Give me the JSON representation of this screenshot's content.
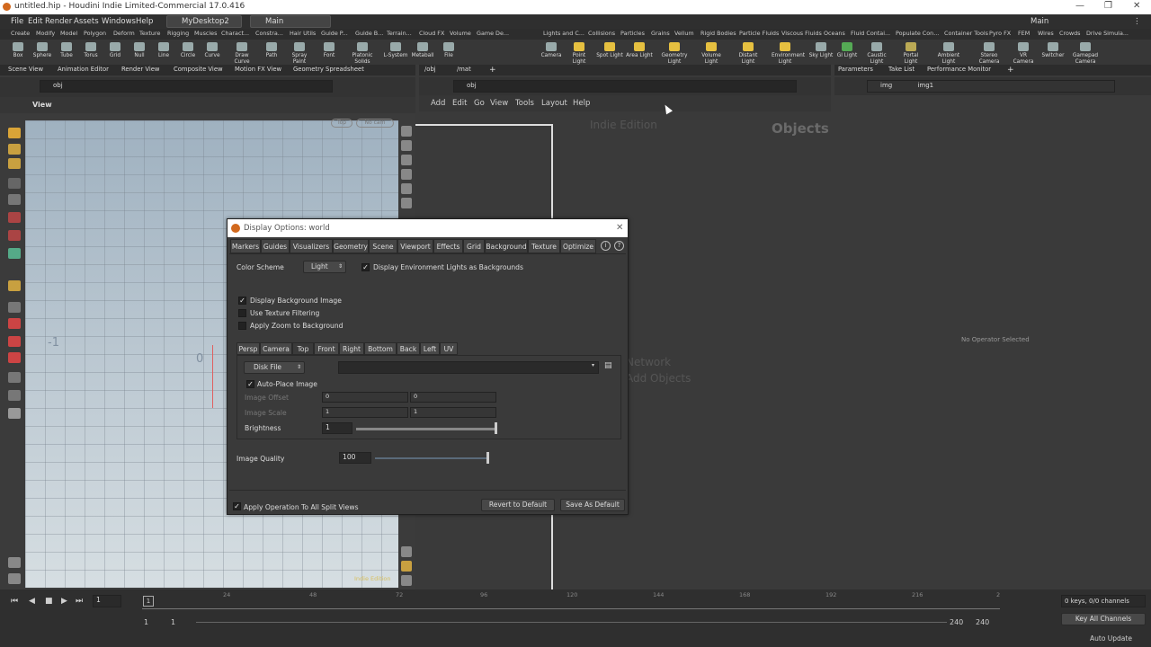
{
  "window": {
    "title": "untitled.hip - Houdini Indie Limited-Commercial 17.0.416",
    "controls": [
      "—",
      "❐",
      "✕"
    ]
  },
  "menu": {
    "items": [
      "File",
      "Edit",
      "Render",
      "Assets",
      "Windows",
      "Help"
    ],
    "desktop": "MyDesktop2",
    "workspace": "Main",
    "right_label": "Main"
  },
  "shelf_tabs_left": [
    "Create",
    "Modify",
    "Model",
    "Polygon",
    "Deform",
    "Texture",
    "Rigging",
    "Muscles",
    "Charact...",
    "Constra...",
    "Hair Utils",
    "Guide P...",
    "Guide B...",
    "Terrain...",
    "Cloud FX",
    "Volume",
    "Game De..."
  ],
  "shelf_tabs_right": [
    "Lights and C...",
    "Collisions",
    "Particles",
    "Grains",
    "Vellum",
    "Rigid Bodies",
    "Particle Fluids",
    "Viscous Fluids",
    "Oceans",
    "Fluid Contai...",
    "Populate Con...",
    "Container Tools",
    "Pyro FX",
    "FEM",
    "Wires",
    "Crowds",
    "Drive Simula..."
  ],
  "tools_left": [
    "Box",
    "Sphere",
    "Tube",
    "Torus",
    "Grid",
    "Null",
    "Line",
    "Circle",
    "Curve",
    "Draw Curve",
    "Path",
    "Spray Paint",
    "Font",
    "Platonic Solids",
    "L-System",
    "Metaball",
    "File"
  ],
  "tools_right": [
    "Camera",
    "Point Light",
    "Spot Light",
    "Area Light",
    "Geometry Light",
    "Volume Light",
    "Distant Light",
    "Environment Light",
    "Sky Light",
    "GI Light",
    "Caustic Light",
    "Portal Light",
    "Ambient Light",
    "Stereo Camera",
    "VR Camera",
    "Switcher",
    "Gamepad Camera"
  ],
  "left_panel": {
    "tabs": [
      "Scene View",
      "Animation Editor",
      "Render View",
      "Composite View",
      "Motion FX View",
      "Geometry Spreadsheet"
    ],
    "path": "obj",
    "view_label": "View",
    "persp": "Top",
    "cam": "No cam",
    "axis_neg1": "-1",
    "axis_0": "0",
    "watermark": "Indie Edition"
  },
  "network": {
    "tabs": [
      "/obj",
      "/mat"
    ],
    "path": "obj",
    "menus": [
      "Add",
      "Edit",
      "Go",
      "View",
      "Tools",
      "Layout",
      "Help"
    ],
    "edition": "Indie Edition",
    "context": "Objects",
    "hint_line1": "Network",
    "hint_line2": "Add Objects"
  },
  "params": {
    "tabs": [
      "Parameters",
      "Take List",
      "Performance Monitor"
    ],
    "path1": "img",
    "path2": "img1",
    "empty_msg": "No Operator Selected"
  },
  "dialog": {
    "title": "Display Options:  world",
    "tabs": [
      "Markers",
      "Guides",
      "Visualizers",
      "Geometry",
      "Scene",
      "Viewport",
      "Effects",
      "Grid",
      "Background",
      "Texture",
      "Optimize"
    ],
    "active_tab": "Background",
    "color_scheme_label": "Color Scheme",
    "color_scheme_value": "Light",
    "env_lights_label": "Display Environment Lights as Backgrounds",
    "display_bg_label": "Display Background Image",
    "texture_filter_label": "Use Texture Filtering",
    "zoom_bg_label": "Apply Zoom to Background",
    "view_tabs": [
      "Persp",
      "Camera",
      "Top",
      "Front",
      "Right",
      "Bottom",
      "Back",
      "Left",
      "UV"
    ],
    "source_value": "Disk File",
    "auto_place_label": "Auto-Place Image",
    "image_offset_label": "Image Offset",
    "offset_x": "0",
    "offset_y": "0",
    "image_scale_label": "Image Scale",
    "scale_x": "1",
    "scale_y": "1",
    "brightness_label": "Brightness",
    "brightness_value": "1",
    "image_quality_label": "Image Quality",
    "image_quality_value": "100",
    "apply_split_label": "Apply Operation To All Split Views",
    "revert_label": "Revert to Default",
    "save_label": "Save As Default"
  },
  "timeline": {
    "ticks": [
      "24",
      "48",
      "72",
      "96",
      "120",
      "144",
      "168",
      "192",
      "216",
      "2"
    ],
    "frame": "1",
    "start": "1",
    "start2": "1",
    "end": "240",
    "end2": "240",
    "keys_info": "0 keys, 0/0 channels",
    "key_all": "Key All Channels",
    "auto_update": "Auto Update"
  }
}
